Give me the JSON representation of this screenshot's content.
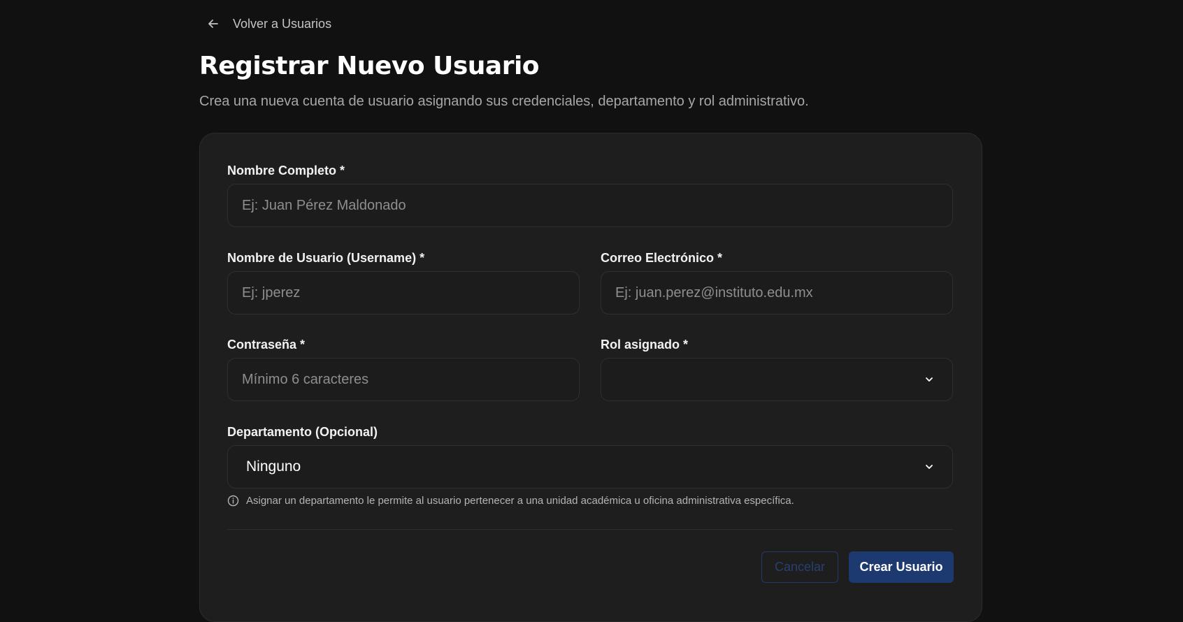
{
  "nav": {
    "back_label": "Volver a Usuarios"
  },
  "header": {
    "title": "Registrar Nuevo Usuario",
    "subtitle": "Crea una nueva cuenta de usuario asignando sus credenciales, departamento y rol administrativo."
  },
  "form": {
    "full_name": {
      "label": "Nombre Completo *",
      "placeholder": "Ej: Juan Pérez Maldonado",
      "value": ""
    },
    "username": {
      "label": "Nombre de Usuario (Username) *",
      "placeholder": "Ej: jperez",
      "value": ""
    },
    "email": {
      "label": "Correo Electrónico *",
      "placeholder": "Ej: juan.perez@instituto.edu.mx",
      "value": ""
    },
    "password": {
      "label": "Contraseña *",
      "placeholder": "Mínimo 6 caracteres",
      "value": ""
    },
    "role": {
      "label": "Rol asignado *",
      "selected": ""
    },
    "department": {
      "label": "Departamento (Opcional)",
      "selected": "Ninguno",
      "helper": "Asignar un departamento le permite al usuario pertenecer a una unidad académica u oficina administrativa específica."
    },
    "actions": {
      "cancel_label": "Cancelar",
      "submit_label": "Crear Usuario"
    }
  },
  "icons": {
    "back": "arrow-left-icon",
    "chevron": "chevron-down-icon",
    "info": "info-circle-icon"
  },
  "colors": {
    "background": "#111111",
    "card": "#1e1e1e",
    "primary": "#1d3a70",
    "muted_text": "#a7a7a7"
  }
}
